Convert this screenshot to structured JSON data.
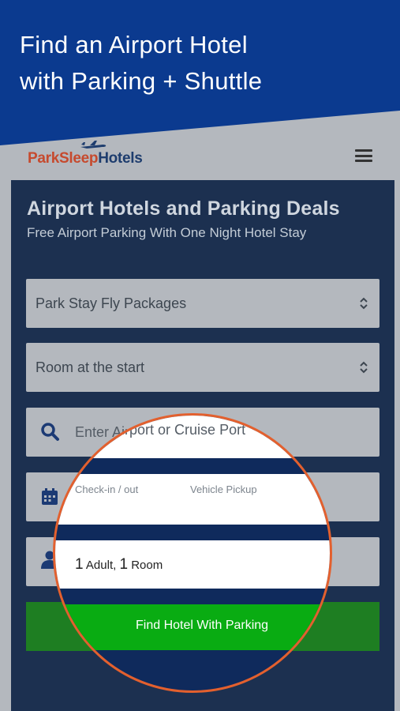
{
  "hero": {
    "title_line1": "Find an Airport Hotel",
    "title_line2": "with Parking + Shuttle",
    "bg_color": "#0b3a8f"
  },
  "brand": {
    "logo_part1": "ParkSleep",
    "logo_part2": "Hotels",
    "logo_icon": "airplane-icon",
    "menu_icon": "hamburger-menu-icon"
  },
  "search_panel": {
    "title": "Airport Hotels and Parking Deals",
    "subtitle": "Free Airport Parking With One Night Hotel Stay",
    "package_select": {
      "value": "Park Stay Fly Packages",
      "icon": "up-down-chevron-icon"
    },
    "parking_select": {
      "value": "Room at the start",
      "icon": "up-down-chevron-icon"
    },
    "airport_input": {
      "placeholder": "Enter Airport or Cruise Port",
      "icon": "search-icon"
    },
    "dates": {
      "checkin_label": "Check-in / out",
      "pickup_label": "Vehicle Pickup",
      "icon": "calendar-icon"
    },
    "guests": {
      "adults_count": "1",
      "adults_label": "Adult,",
      "rooms_count": "1",
      "rooms_label": "Room",
      "icon": "person-icon"
    },
    "submit_label": "Find Hotel With Parking"
  },
  "colors": {
    "panel": "#1c3050",
    "button": "#1e7e22",
    "button_magnified": "#09ac12",
    "magnifier_ring": "#e3602e"
  }
}
